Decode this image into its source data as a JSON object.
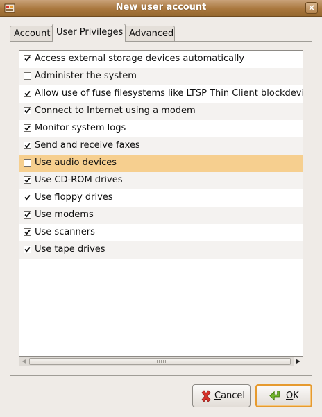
{
  "window": {
    "title": "New user account",
    "close_glyph": "×"
  },
  "tabs": [
    {
      "label": "Account",
      "active": false
    },
    {
      "label": "User Privileges",
      "active": true
    },
    {
      "label": "Advanced",
      "active": false
    }
  ],
  "privileges": [
    {
      "label": "Access external storage devices automatically",
      "checked": true
    },
    {
      "label": "Administer the system",
      "checked": false
    },
    {
      "label": "Allow use of fuse filesystems like LTSP Thin Client blockdevice",
      "checked": true
    },
    {
      "label": "Connect to Internet using a modem",
      "checked": true
    },
    {
      "label": "Monitor system logs",
      "checked": true
    },
    {
      "label": "Send and receive faxes",
      "checked": true
    },
    {
      "label": "Use audio devices",
      "checked": false,
      "highlighted": true
    },
    {
      "label": "Use CD-ROM drives",
      "checked": true
    },
    {
      "label": "Use floppy drives",
      "checked": true
    },
    {
      "label": "Use modems",
      "checked": true
    },
    {
      "label": "Use scanners",
      "checked": true
    },
    {
      "label": "Use tape drives",
      "checked": true
    }
  ],
  "buttons": {
    "cancel": {
      "mnemonic": "C",
      "rest": "ancel",
      "icon": "cancel-x-icon"
    },
    "ok": {
      "mnemonic": "O",
      "rest": "K",
      "icon": "ok-arrow-icon"
    }
  },
  "colors": {
    "titlebar": "#a9773e",
    "selection": "#f6cf8f",
    "ok_focus": "#e69a2f",
    "cancel_icon": "#d8322a",
    "ok_icon": "#4e9a06"
  }
}
